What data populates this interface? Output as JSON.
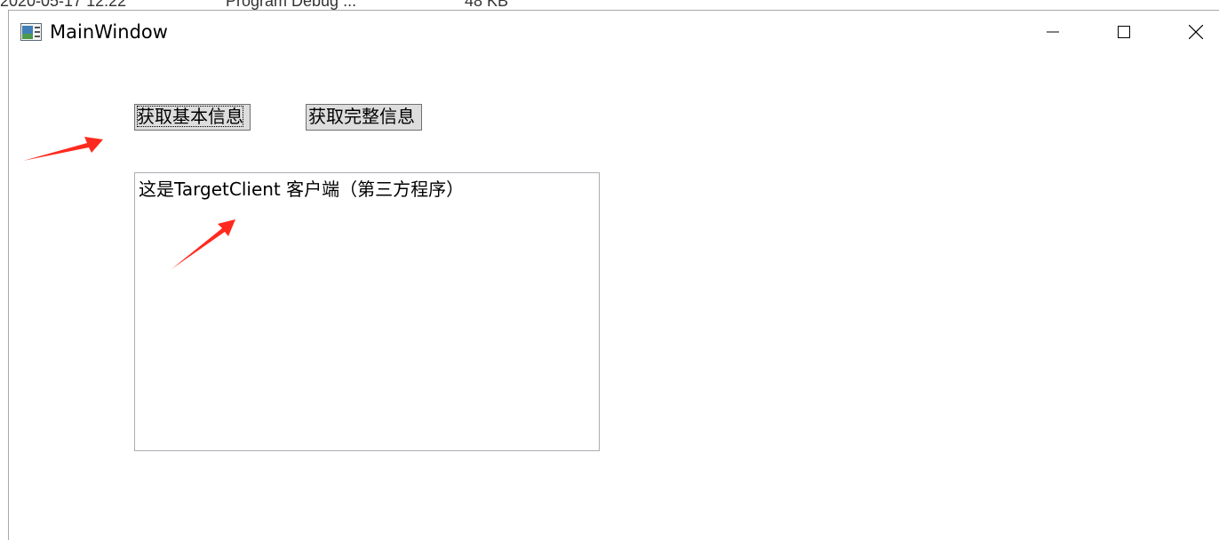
{
  "background_strip": {
    "date": "2020-05-17 12:22",
    "type": "Program Debug ...",
    "size": "48 KB"
  },
  "window": {
    "title": "MainWindow",
    "icon": "app-window-icon",
    "controls": {
      "minimize_icon": "minimize-icon",
      "maximize_icon": "maximize-icon",
      "close_icon": "close-icon"
    }
  },
  "buttons": {
    "basic_info_label": "获取基本信息",
    "full_info_label": "获取完整信息"
  },
  "textbox": {
    "content": "这是TargetClient 客户端（第三方程序）"
  },
  "annotations": {
    "arrow_color": "#ff2a1f"
  },
  "colors": {
    "button_face": "#dddddd",
    "button_border": "#707070",
    "textbox_border": "#abadb3"
  }
}
